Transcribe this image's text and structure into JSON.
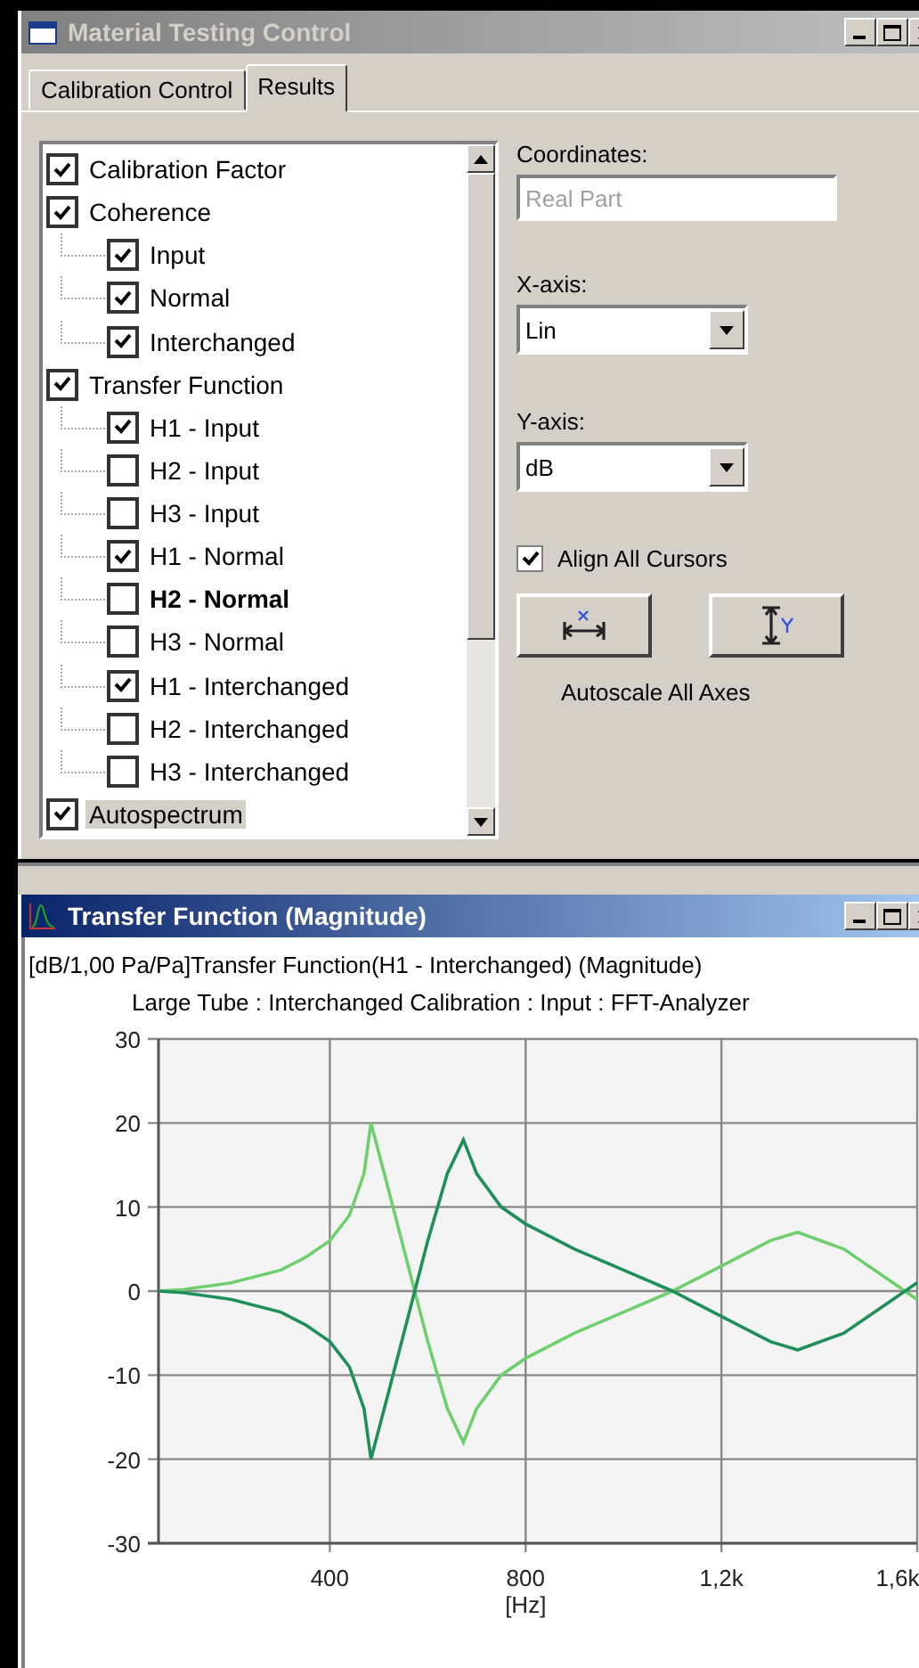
{
  "control_window": {
    "title": "Material Testing Control",
    "active": false,
    "tabs": [
      {
        "label": "Calibration Control",
        "selected": false
      },
      {
        "label": "Results",
        "selected": true
      }
    ],
    "tree": [
      {
        "label": "Calibration Factor",
        "checked": true,
        "selected": false,
        "current": false
      },
      {
        "label": "Coherence",
        "checked": true,
        "selected": false,
        "current": false,
        "children": [
          {
            "label": "Input",
            "checked": true,
            "selected": false,
            "current": false
          },
          {
            "label": "Normal",
            "checked": true,
            "selected": false,
            "current": false
          },
          {
            "label": "Interchanged",
            "checked": true,
            "selected": false,
            "current": false
          }
        ]
      },
      {
        "label": "Transfer Function",
        "checked": true,
        "selected": false,
        "current": false,
        "children": [
          {
            "label": "H1 - Input",
            "checked": true,
            "selected": false,
            "current": false
          },
          {
            "label": "H2 - Input",
            "checked": false,
            "selected": false,
            "current": false
          },
          {
            "label": "H3 - Input",
            "checked": false,
            "selected": false,
            "current": false
          },
          {
            "label": "H1 - Normal",
            "checked": true,
            "selected": false,
            "current": false
          },
          {
            "label": "H2 - Normal",
            "checked": false,
            "selected": false,
            "current": true
          },
          {
            "label": "H3 - Normal",
            "checked": false,
            "selected": false,
            "current": false
          },
          {
            "label": "H1 - Interchanged",
            "checked": true,
            "selected": false,
            "current": false
          },
          {
            "label": "H2 - Interchanged",
            "checked": false,
            "selected": false,
            "current": false
          },
          {
            "label": "H3 - Interchanged",
            "checked": false,
            "selected": false,
            "current": false
          }
        ]
      },
      {
        "label": "Autospectrum",
        "checked": true,
        "selected": true,
        "current": false
      }
    ],
    "coordinates": {
      "label": "Coordinates:",
      "value": "Real Part",
      "disabled": true
    },
    "x_axis": {
      "label": "X-axis:",
      "value": "Lin"
    },
    "y_axis": {
      "label": "Y-axis:",
      "value": "dB"
    },
    "align_cursors": {
      "label": "Align All Cursors",
      "checked": true
    },
    "autoscale": {
      "label": "Autoscale All Axes"
    }
  },
  "chart_window": {
    "title": "Transfer Function (Magnitude)",
    "active": true,
    "header": "[dB/1,00 Pa/Pa]Transfer Function(H1 - Interchanged) (Magnitude)",
    "subtitle": "Large Tube : Interchanged Calibration : Input : FFT-Analyzer",
    "chart_data": {
      "type": "line",
      "grid": true,
      "xlabel": "[Hz]",
      "xlim": [
        50,
        1600
      ],
      "ylim": [
        -30,
        30
      ],
      "xticks": [
        400,
        800,
        {
          "value": 1200,
          "label": "1,2k"
        },
        {
          "value": 1600,
          "label": "1,6k"
        }
      ],
      "yticks": [
        30,
        20,
        10,
        0,
        -10,
        -20,
        -30
      ],
      "x": [
        50,
        100,
        200,
        300,
        350,
        400,
        440,
        470,
        484,
        520,
        560,
        600,
        640,
        673,
        700,
        750,
        800,
        900,
        1000,
        1100,
        1200,
        1300,
        1356,
        1450,
        1550,
        1600
      ],
      "series": [
        {
          "color": "#6fcf6f",
          "values": [
            0,
            0.2,
            1,
            2.5,
            4,
            6,
            9,
            14,
            20,
            12,
            3,
            -6,
            -14,
            -18,
            -14,
            -10,
            -8,
            -5,
            -2.5,
            0,
            3,
            6,
            7,
            5,
            1,
            -1
          ]
        },
        {
          "color": "#1f8f5a",
          "values": [
            0,
            -0.2,
            -1,
            -2.5,
            -4,
            -6,
            -9,
            -14,
            -20,
            -12,
            -3,
            6,
            14,
            18,
            14,
            10,
            8,
            5,
            2.5,
            0,
            -3,
            -6,
            -7,
            -5,
            -1,
            1
          ]
        }
      ]
    }
  }
}
